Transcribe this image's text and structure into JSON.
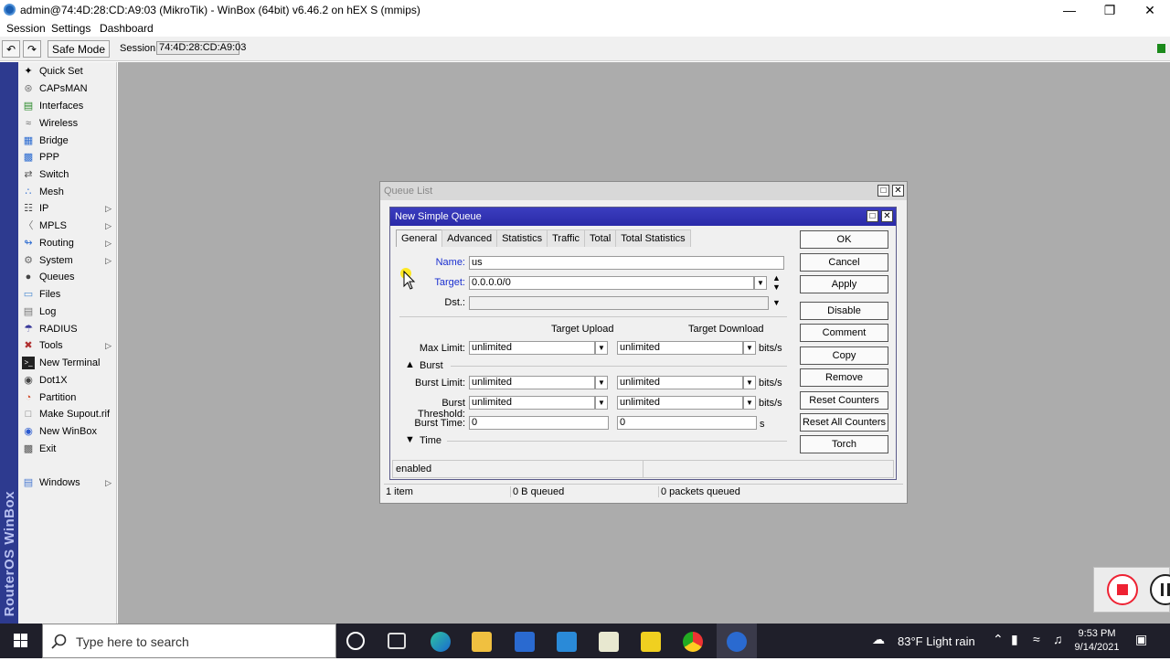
{
  "window": {
    "title": "admin@74:4D:28:CD:A9:03 (MikroTik) - WinBox (64bit) v6.46.2 on hEX S (mmips)",
    "controls": [
      "minimize",
      "restore",
      "close"
    ]
  },
  "menu": [
    "Session",
    "Settings",
    "Dashboard"
  ],
  "toolbar": {
    "undo_icon": "undo-icon",
    "redo_icon": "redo-icon",
    "safe_mode": "Safe Mode",
    "session_label": "Session:",
    "session_value": "74:4D:28:CD:A9:03",
    "status_color": "#1b8a1b"
  },
  "sidebar": {
    "brand": "RouterOS WinBox",
    "items": [
      {
        "label": "Quick Set",
        "icon": "wand-icon",
        "submenu": false
      },
      {
        "label": "CAPsMAN",
        "icon": "capsman-icon",
        "submenu": false
      },
      {
        "label": "Interfaces",
        "icon": "interfaces-icon",
        "submenu": false
      },
      {
        "label": "Wireless",
        "icon": "wireless-icon",
        "submenu": false
      },
      {
        "label": "Bridge",
        "icon": "bridge-icon",
        "submenu": false
      },
      {
        "label": "PPP",
        "icon": "ppp-icon",
        "submenu": false
      },
      {
        "label": "Switch",
        "icon": "switch-icon",
        "submenu": false
      },
      {
        "label": "Mesh",
        "icon": "mesh-icon",
        "submenu": false
      },
      {
        "label": "IP",
        "icon": "ip-icon",
        "submenu": true
      },
      {
        "label": "MPLS",
        "icon": "mpls-icon",
        "submenu": true
      },
      {
        "label": "Routing",
        "icon": "routing-icon",
        "submenu": true
      },
      {
        "label": "System",
        "icon": "gear-icon",
        "submenu": true
      },
      {
        "label": "Queues",
        "icon": "queues-icon",
        "submenu": false
      },
      {
        "label": "Files",
        "icon": "folder-icon",
        "submenu": false
      },
      {
        "label": "Log",
        "icon": "log-icon",
        "submenu": false
      },
      {
        "label": "RADIUS",
        "icon": "radius-icon",
        "submenu": false
      },
      {
        "label": "Tools",
        "icon": "tools-icon",
        "submenu": true
      },
      {
        "label": "New Terminal",
        "icon": "terminal-icon",
        "submenu": false
      },
      {
        "label": "Dot1X",
        "icon": "dot1x-icon",
        "submenu": false
      },
      {
        "label": "Partition",
        "icon": "partition-icon",
        "submenu": false
      },
      {
        "label": "Make Supout.rif",
        "icon": "file-icon",
        "submenu": false
      },
      {
        "label": "New WinBox",
        "icon": "winbox-icon",
        "submenu": false
      },
      {
        "label": "Exit",
        "icon": "exit-icon",
        "submenu": false
      }
    ],
    "windows_item": {
      "label": "Windows",
      "icon": "windows-icon",
      "submenu": true
    }
  },
  "queue_list": {
    "title": "Queue List",
    "status": [
      "1 item",
      "0 B queued",
      "0 packets queued"
    ]
  },
  "dialog": {
    "title": "New Simple Queue",
    "tabs": [
      "General",
      "Advanced",
      "Statistics",
      "Traffic",
      "Total",
      "Total Statistics"
    ],
    "active_tab": "General",
    "name_label": "Name:",
    "name_value": "us",
    "target_label": "Target:",
    "target_value": "0.0.0.0/0",
    "dst_label": "Dst.:",
    "dst_value": "",
    "col_upload": "Target Upload",
    "col_download": "Target Download",
    "max_limit_label": "Max Limit:",
    "max_limit_up": "unlimited",
    "max_limit_down": "unlimited",
    "burst_section": "Burst",
    "burst_limit_label": "Burst Limit:",
    "burst_limit_up": "unlimited",
    "burst_limit_down": "unlimited",
    "burst_threshold_label": "Burst Threshold:",
    "burst_threshold_up": "unlimited",
    "burst_threshold_down": "unlimited",
    "burst_time_label": "Burst Time:",
    "burst_time_up": "0",
    "burst_time_down": "0",
    "time_section": "Time",
    "unit_bits": "bits/s",
    "unit_s": "s",
    "status": "enabled",
    "buttons": [
      "OK",
      "Cancel",
      "Apply",
      "Disable",
      "Comment",
      "Copy",
      "Remove",
      "Reset Counters",
      "Reset All Counters",
      "Torch"
    ]
  },
  "taskbar": {
    "search_placeholder": "Type here to search",
    "weather": "83°F  Light rain",
    "time": "9:53 PM",
    "date": "9/14/2021"
  }
}
